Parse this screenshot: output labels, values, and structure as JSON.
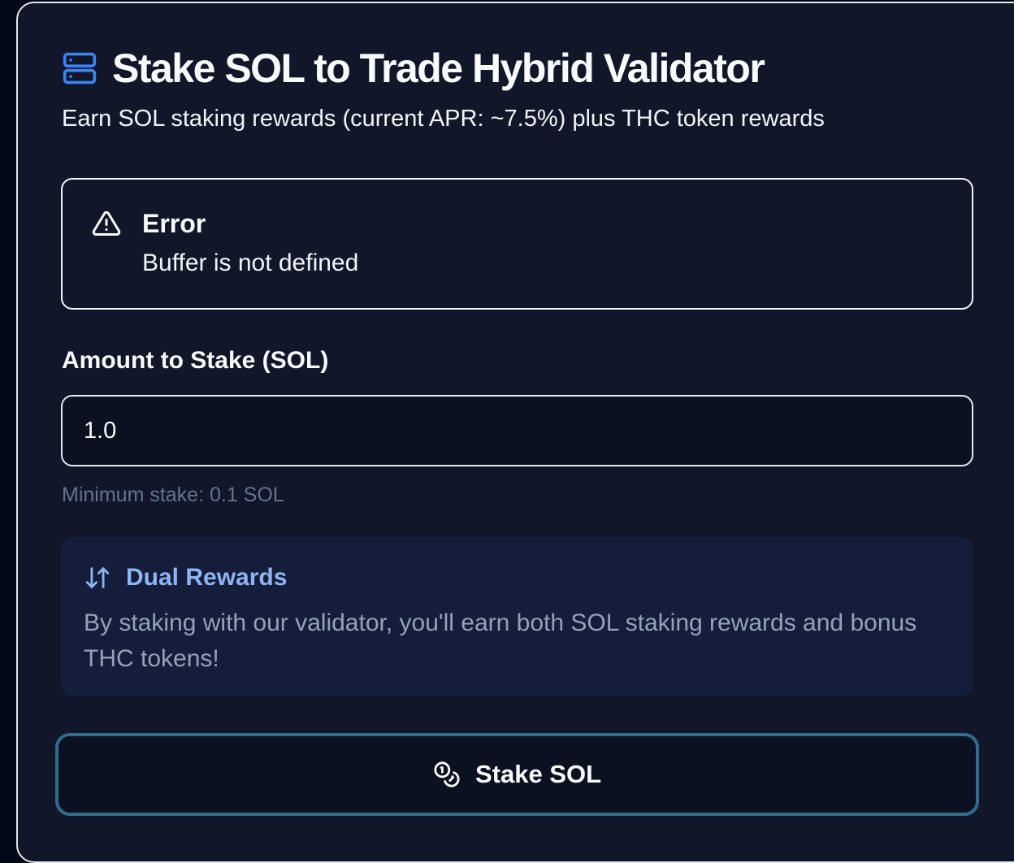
{
  "header": {
    "title": "Stake SOL to Trade Hybrid Validator",
    "subtitle": "Earn SOL staking rewards (current APR: ~7.5%) plus THC token rewards",
    "icon": "server-icon"
  },
  "alert": {
    "title": "Error",
    "description": "Buffer is not defined",
    "icon": "alert-triangle-icon"
  },
  "form": {
    "amount_label": "Amount to Stake (SOL)",
    "amount_value": "1.0",
    "hint": "Minimum stake: 0.1 SOL"
  },
  "info": {
    "title": "Dual Rewards",
    "description": "By staking with our validator, you'll earn both SOL staking rewards and bonus THC tokens!",
    "icon": "arrow-up-down-icon"
  },
  "actions": {
    "stake_label": "Stake SOL",
    "stake_icon": "coins-icon"
  },
  "colors": {
    "background": "#111729",
    "accent_blue": "#3b82f6",
    "info_title": "#8fb4f3",
    "button_border": "#2f6d8e"
  }
}
